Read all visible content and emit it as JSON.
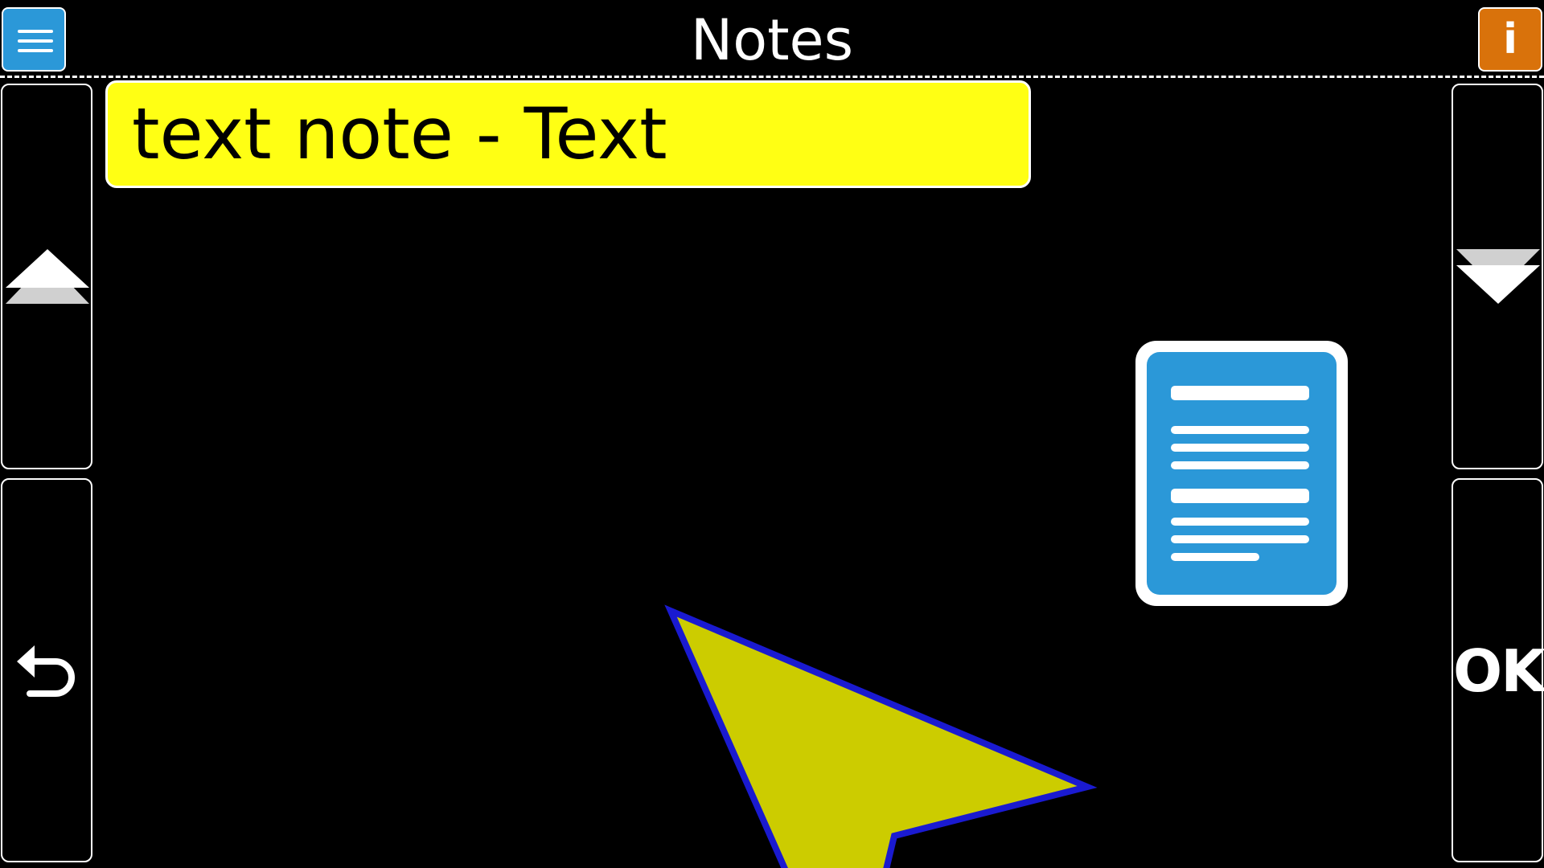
{
  "header": {
    "title": "Notes",
    "info_label": "i"
  },
  "note": {
    "label": "text note - Text"
  },
  "buttons": {
    "ok_label": "OK"
  },
  "colors": {
    "background": "#000000",
    "menu_button": "#2b98d8",
    "info_button": "#d9720b",
    "note_highlight": "#ffff14",
    "cursor_fill": "#cccc00",
    "cursor_stroke": "#1a1ad0",
    "document_icon": "#2b98d8"
  },
  "icons": {
    "menu": "hamburger-icon",
    "info": "info-icon",
    "scroll_up": "triangle-up-icon",
    "scroll_down": "triangle-down-icon",
    "back": "return-arrow-icon",
    "note_type": "text-document-icon",
    "position": "navigation-arrow-icon"
  }
}
